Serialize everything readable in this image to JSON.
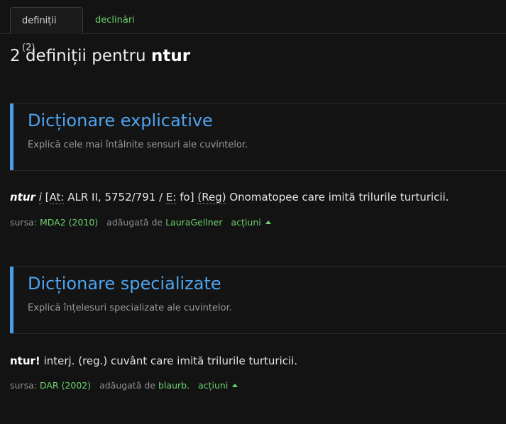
{
  "tabs": [
    {
      "label": "definiții (2)"
    },
    {
      "label": "declinări"
    }
  ],
  "title": {
    "prefix": "2 definiții pentru",
    "word": "ntur"
  },
  "sections": [
    {
      "heading": "Dicționare explicative",
      "subtitle": "Explică cele mai întâlnite sensuri ale cuvintelor.",
      "definition": {
        "lemma": "ntur",
        "gram": "i",
        "src_open": "[",
        "at_label": "At:",
        "at_value": "ALR II, 5752/791",
        "sep": "/",
        "e_label": "E:",
        "e_value": "fo",
        "src_close": "]",
        "reg": "(Reg)",
        "text": "Onomatopee care imită trilurile turturicii."
      },
      "meta": {
        "source_label": "sursa:",
        "source": "MDA2 (2010)",
        "added_label": "adăugată de",
        "author": "LauraGellner",
        "actions": "acțiuni"
      }
    },
    {
      "heading": "Dicționare specializate",
      "subtitle": "Explică înțelesuri specializate ale cuvintelor.",
      "definition": {
        "lemma": "ntur!",
        "text": "interj. (reg.) cuvânt care imită trilurile turturicii."
      },
      "meta": {
        "source_label": "sursa:",
        "source": "DAR (2002)",
        "added_label": "adăugată de",
        "author": "blaurb.",
        "actions": "acțiuni"
      }
    }
  ]
}
